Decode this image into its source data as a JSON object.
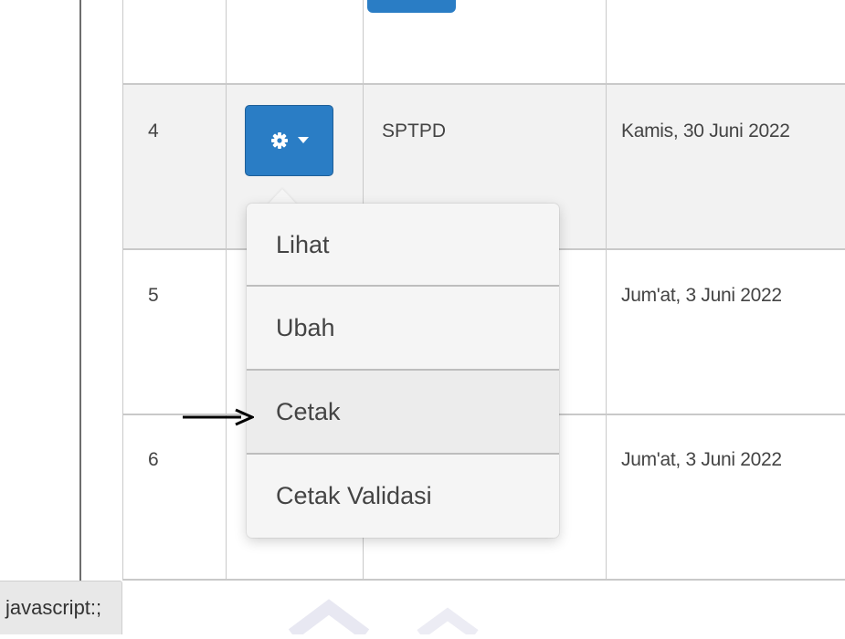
{
  "table": {
    "rows": [
      {
        "number": "4",
        "name": "SPTPD",
        "date": "Kamis, 30 Juni 2022"
      },
      {
        "number": "5",
        "name": "",
        "date": "Jum'at, 3 Juni 2022"
      },
      {
        "number": "6",
        "name": "",
        "date": "Jum'at, 3 Juni 2022"
      }
    ],
    "action_button": {
      "icon": "gear-icon",
      "caret_icon": "caret-down-icon"
    }
  },
  "dropdown": {
    "items": [
      {
        "label": "Lihat"
      },
      {
        "label": "Ubah"
      },
      {
        "label": "Cetak",
        "highlighted": true
      },
      {
        "label": "Cetak Validasi"
      }
    ]
  },
  "annotation": {
    "icon": "right-arrow-icon",
    "points_to": "Cetak"
  },
  "status_bar": {
    "text": "javascript:;"
  },
  "colors": {
    "button": "#2a7dc5",
    "row_alt": "#f2f2f2",
    "border": "#c9c9c9",
    "menu_bg": "#f5f5f5"
  }
}
